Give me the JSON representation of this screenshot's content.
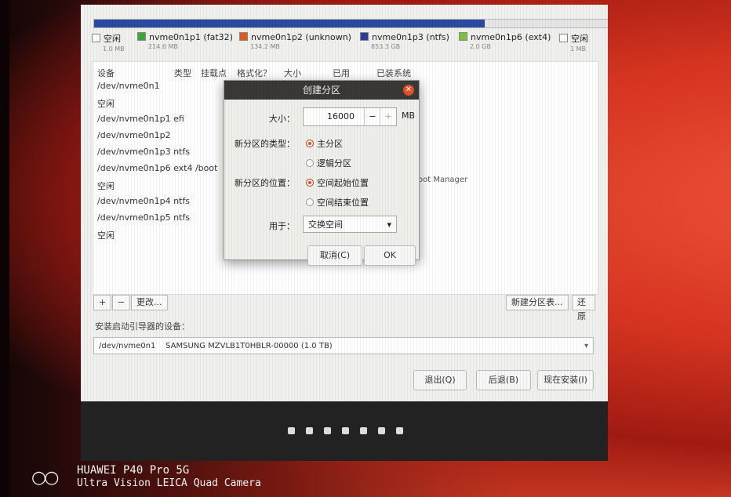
{
  "colors": {
    "fat32": "#3aa83a",
    "unknown": "#e05a1a",
    "ntfs": "#2a3f9a",
    "ext4": "#7ac43a",
    "free": "#ffffff",
    "accent": "#e1502a"
  },
  "usage_fraction": 0.76,
  "legend": [
    {
      "name": "空闲",
      "size": "1.0 MB",
      "color_key": "free"
    },
    {
      "name": "nvme0n1p1 (fat32)",
      "size": "214.6 MB",
      "color_key": "fat32"
    },
    {
      "name": "nvme0n1p2 (unknown)",
      "size": "134.2 MB",
      "color_key": "unknown"
    },
    {
      "name": "nvme0n1p3 (ntfs)",
      "size": "853.3 GB",
      "color_key": "ntfs"
    },
    {
      "name": "nvme0n1p6 (ext4)",
      "size": "2.0 GB",
      "color_key": "ext4"
    },
    {
      "name": "空闲",
      "size": "1 MB",
      "color_key": "free"
    }
  ],
  "table": {
    "columns": [
      "设备",
      "类型",
      "挂载点",
      "格式化？",
      "大小",
      "已用",
      "已装系统"
    ],
    "rows": [
      "/dev/nvme0n1",
      "空闲",
      "/dev/nvme0n1p1 efi",
      "/dev/nvme0n1p2",
      "/dev/nvme0n1p3 ntfs",
      "/dev/nvme0n1p6 ext4  /boot",
      "空闲",
      "/dev/nvme0n1p4 ntfs",
      "/dev/nvme0n1p5 ntfs",
      "空闲"
    ],
    "behind_dialog_text": "oot Manager"
  },
  "toolbar": {
    "add": "+",
    "remove": "−",
    "change": "更改...",
    "new_table": "新建分区表...",
    "revert": "还原"
  },
  "bootloader": {
    "label": "安装启动引导器的设备：",
    "device": "/dev/nvme0n1",
    "model": "SAMSUNG MZVLB1T0HBLR-00000 (1.0 TB)"
  },
  "buttons": {
    "quit": "退出(Q)",
    "back": "后退(B)",
    "install": "现在安装(I)"
  },
  "dialog": {
    "title": "创建分区",
    "size_label": "大小：",
    "size_value": "16000",
    "minus": "−",
    "plus": "+",
    "unit": "MB",
    "type_label": "新分区的类型：",
    "type_primary": "主分区",
    "type_logical": "逻辑分区",
    "location_label": "新分区的位置：",
    "location_start": "空间起始位置",
    "location_end": "空间结束位置",
    "use_label": "用于：",
    "use_value": "交换空间",
    "cancel": "取消(C)",
    "ok": "OK"
  },
  "watermark": {
    "line1": "HUAWEI P40 Pro 5G",
    "line2": "Ultra Vision LEICA Quad Camera"
  }
}
